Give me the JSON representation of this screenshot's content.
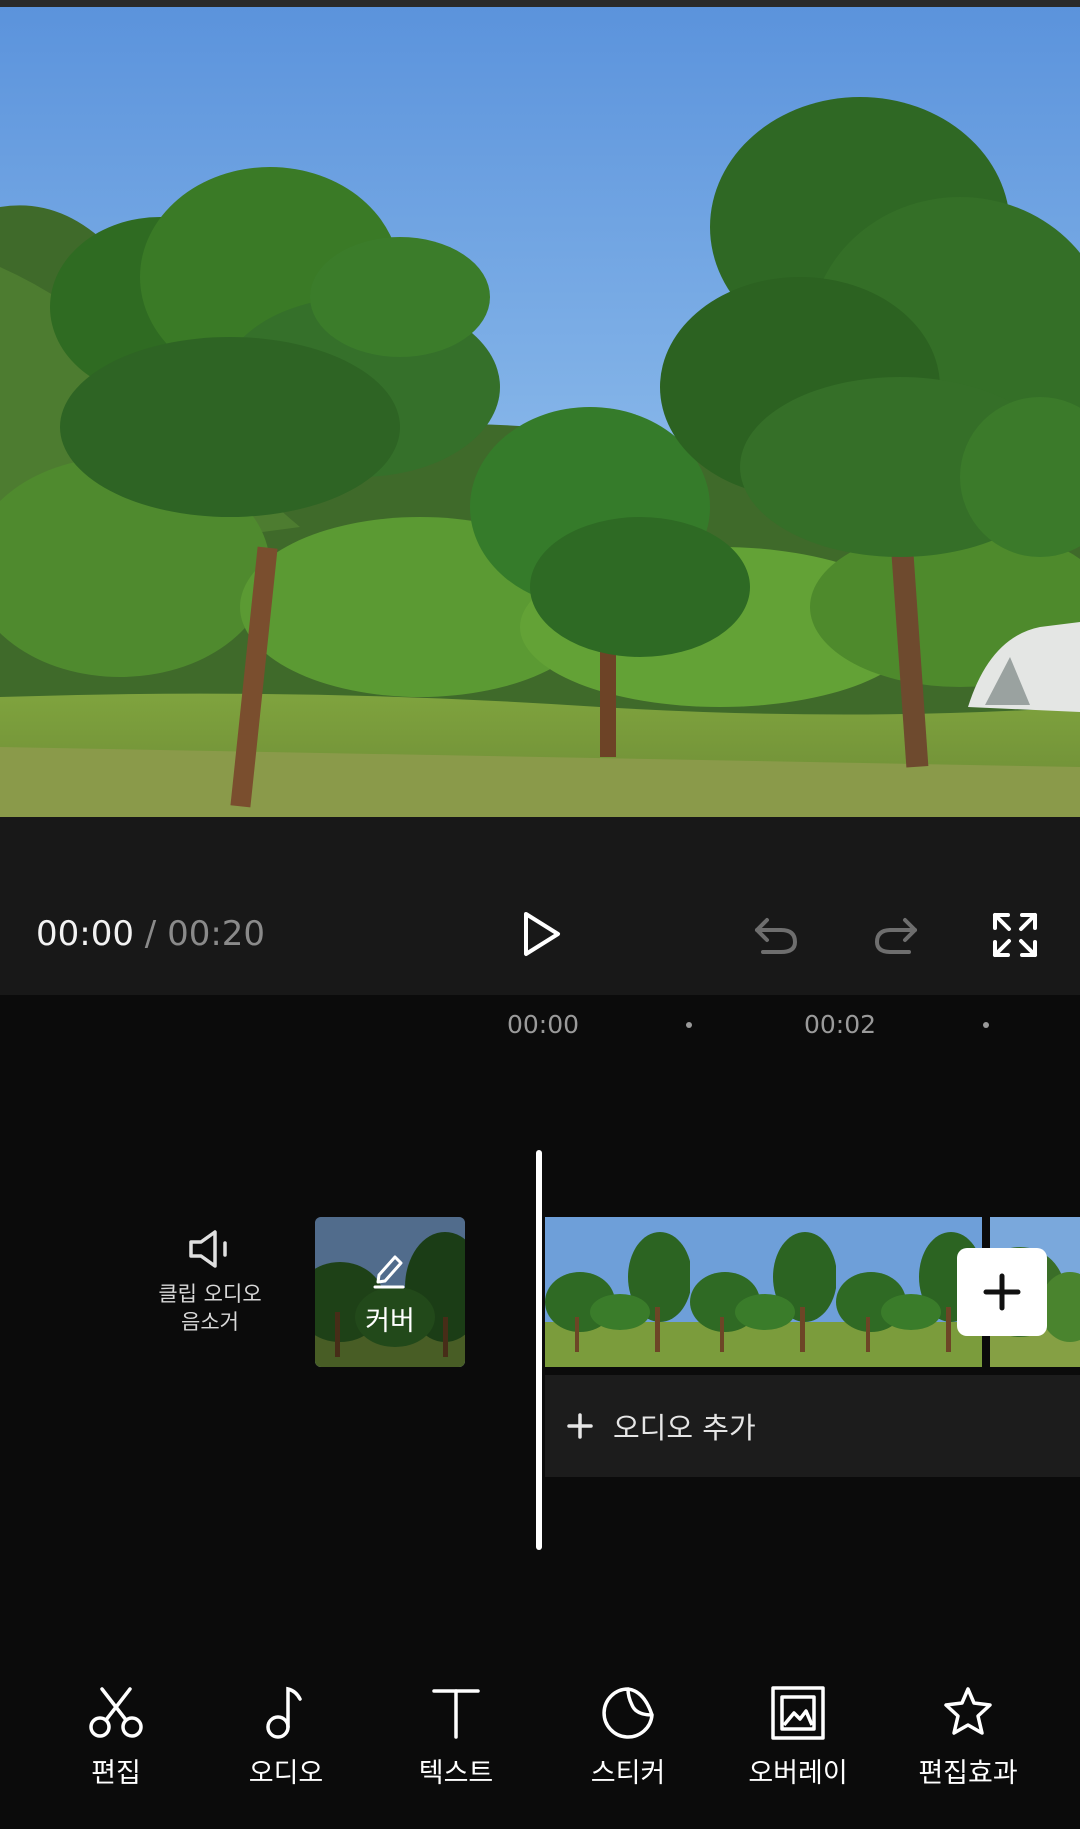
{
  "player": {
    "current_time": "00:00",
    "separator": " / ",
    "total_time": "00:20"
  },
  "timeline": {
    "ruler": [
      "00:00",
      "00:02"
    ],
    "mute_label": [
      "클립 오디오",
      "음소거"
    ],
    "cover_label": "커버",
    "add_audio_label": "오디오 추가"
  },
  "toolbar": {
    "items": [
      {
        "label": "편집",
        "icon": "scissors-icon"
      },
      {
        "label": "오디오",
        "icon": "music-note-icon"
      },
      {
        "label": "텍스트",
        "icon": "text-icon"
      },
      {
        "label": "스티커",
        "icon": "sticker-icon"
      },
      {
        "label": "오버레이",
        "icon": "overlay-icon"
      },
      {
        "label": "편집효과",
        "icon": "effects-star-icon"
      }
    ]
  },
  "icons": {
    "play": "play-icon",
    "undo": "undo-icon",
    "redo": "redo-icon",
    "fullscreen": "fullscreen-icon",
    "mute": "speaker-mute-icon",
    "cover_edit": "pencil-icon",
    "add_clip": "plus-icon",
    "add_audio": "plus-icon"
  },
  "colors": {
    "background": "#0b0b0b",
    "control_bar": "#181818",
    "audio_track": "#1c1c1c",
    "text_dim": "#8a8a8a"
  }
}
